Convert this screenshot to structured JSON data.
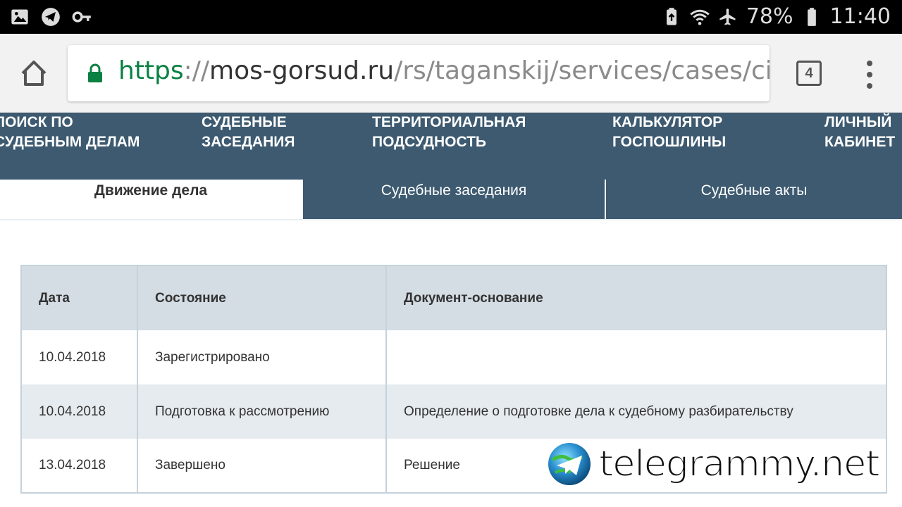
{
  "status_bar": {
    "battery_percent": "78%",
    "time": "11:40"
  },
  "browser": {
    "url_scheme": "https",
    "url_separator": "://",
    "url_host": "mos-gorsud.ru",
    "url_path": "/rs/taganskij/services/cases/civil/de",
    "tab_count": "4"
  },
  "site_nav": {
    "items": [
      {
        "label": "Поиск по\nсудебным делам"
      },
      {
        "label": "Судебные\nзаседания"
      },
      {
        "label": "Территориальная\nподсудность"
      },
      {
        "label": "Калькулятор\nгоспошлины"
      },
      {
        "label": "Личный\nкабинет"
      }
    ]
  },
  "tabs": [
    {
      "label": "Движение дела",
      "active": true
    },
    {
      "label": "Судебные заседания",
      "active": false
    },
    {
      "label": "Судебные акты",
      "active": false
    }
  ],
  "table": {
    "headers": [
      "Дата",
      "Состояние",
      "Документ-основание"
    ],
    "rows": [
      [
        "10.04.2018",
        "Зарегистрировано",
        ""
      ],
      [
        "10.04.2018",
        "Подготовка к рассмотрению",
        "Определение о подготовке дела к судебному разбирательству"
      ],
      [
        "13.04.2018",
        "Завершено",
        "Решение"
      ]
    ]
  },
  "watermark": {
    "text": "telegrammy.net"
  },
  "colors": {
    "nav_bg": "#3d5a70",
    "secure_green": "#0b8043",
    "table_header_bg": "#d4dde4",
    "table_alt_bg": "#e6ebef"
  }
}
